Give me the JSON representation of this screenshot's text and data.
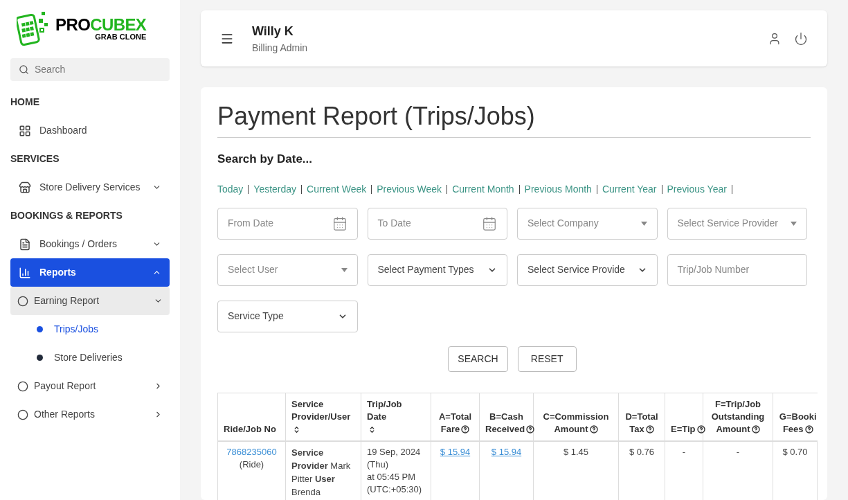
{
  "logo": {
    "part1": "PRO",
    "part2": "CUBEX",
    "tagline": "GRAB CLONE"
  },
  "sidebar": {
    "search": {
      "placeholder": "Search"
    },
    "sections": [
      {
        "heading": "HOME",
        "items": [
          {
            "label": "Dashboard",
            "selected": false
          }
        ]
      },
      {
        "heading": "SERVICES",
        "items": [
          {
            "label": "Store Delivery Services",
            "selected": false,
            "expanded": false
          }
        ]
      },
      {
        "heading": "BOOKINGS & REPORTS",
        "items": [
          {
            "label": "Bookings / Orders",
            "selected": false,
            "expanded": false
          },
          {
            "label": "Reports",
            "selected": true,
            "expanded": true,
            "children": [
              {
                "label": "Earning Report",
                "selected": true,
                "expanded": true,
                "children": [
                  {
                    "label": "Trips/Jobs",
                    "selected": true
                  },
                  {
                    "label": "Store Deliveries",
                    "selected": false
                  }
                ]
              },
              {
                "label": "Payout Report",
                "selected": false,
                "expanded": false
              },
              {
                "label": "Other Reports",
                "selected": false,
                "expanded": false
              }
            ]
          }
        ]
      }
    ]
  },
  "header": {
    "user_name": "Willy K",
    "role": "Billing Admin"
  },
  "page": {
    "title": "Payment Report (Trips/Jobs)",
    "search_heading": "Search by Date...",
    "date_ranges": [
      "Today",
      "Yesterday",
      "Current Week",
      "Previous Week",
      "Current Month",
      "Previous Month",
      "Current Year",
      "Previous Year"
    ],
    "filters": [
      {
        "kind": "date",
        "placeholder": "From Date"
      },
      {
        "kind": "date",
        "placeholder": "To Date"
      },
      {
        "kind": "picker",
        "placeholder": "Select Company"
      },
      {
        "kind": "picker",
        "placeholder": "Select Service Provider"
      },
      {
        "kind": "picker",
        "placeholder": "Select User"
      },
      {
        "kind": "select",
        "value": "Select Payment Types"
      },
      {
        "kind": "select",
        "value": "Select Service Provide"
      },
      {
        "kind": "text",
        "placeholder": "Trip/Job Number"
      },
      {
        "kind": "select",
        "value": "Service Type"
      }
    ],
    "buttons": [
      "SEARCH",
      "RESET"
    ],
    "table": {
      "columns": [
        {
          "lines": [
            "Ride/Job No"
          ],
          "kind": "plain"
        },
        {
          "lines": [
            "Service",
            "Provider/User"
          ],
          "kind": "sortable"
        },
        {
          "lines": [
            "Trip/Job",
            "Date"
          ],
          "kind": "sortable"
        },
        {
          "lines": [
            "A=Total",
            "Fare"
          ],
          "kind": "info"
        },
        {
          "lines": [
            "B=Cash",
            "Received"
          ],
          "kind": "info"
        },
        {
          "lines": [
            "C=Commission",
            "Amount"
          ],
          "kind": "info"
        },
        {
          "lines": [
            "D=Total",
            "Tax"
          ],
          "kind": "info"
        },
        {
          "lines": [
            "E=Tip"
          ],
          "kind": "info"
        },
        {
          "lines": [
            "F=Trip/Job",
            "Outstanding",
            "Amount"
          ],
          "kind": "info"
        },
        {
          "lines": [
            "G=Booki",
            "Fees"
          ],
          "kind": "info"
        }
      ],
      "rows": [
        {
          "cells": [
            {
              "kind": "id",
              "link": "7868235060",
              "note": "(Ride)"
            },
            {
              "kind": "rich",
              "text": "**Service Provider** Mark Pitter **User** Brenda"
            },
            {
              "kind": "lines",
              "lines": [
                "19 Sep, 2024",
                "(Thu)",
                "at 05:45 PM",
                "(UTC:+05:30)"
              ]
            },
            {
              "kind": "link",
              "text": "$ 15.94"
            },
            {
              "kind": "link",
              "text": "$ 15.94"
            },
            {
              "kind": "plain",
              "text": "$ 1.45"
            },
            {
              "kind": "plain",
              "text": "$ 0.76"
            },
            {
              "kind": "plain",
              "text": "-"
            },
            {
              "kind": "plain",
              "text": "-"
            },
            {
              "kind": "plain",
              "text": "$ 0.70"
            }
          ]
        }
      ]
    }
  }
}
